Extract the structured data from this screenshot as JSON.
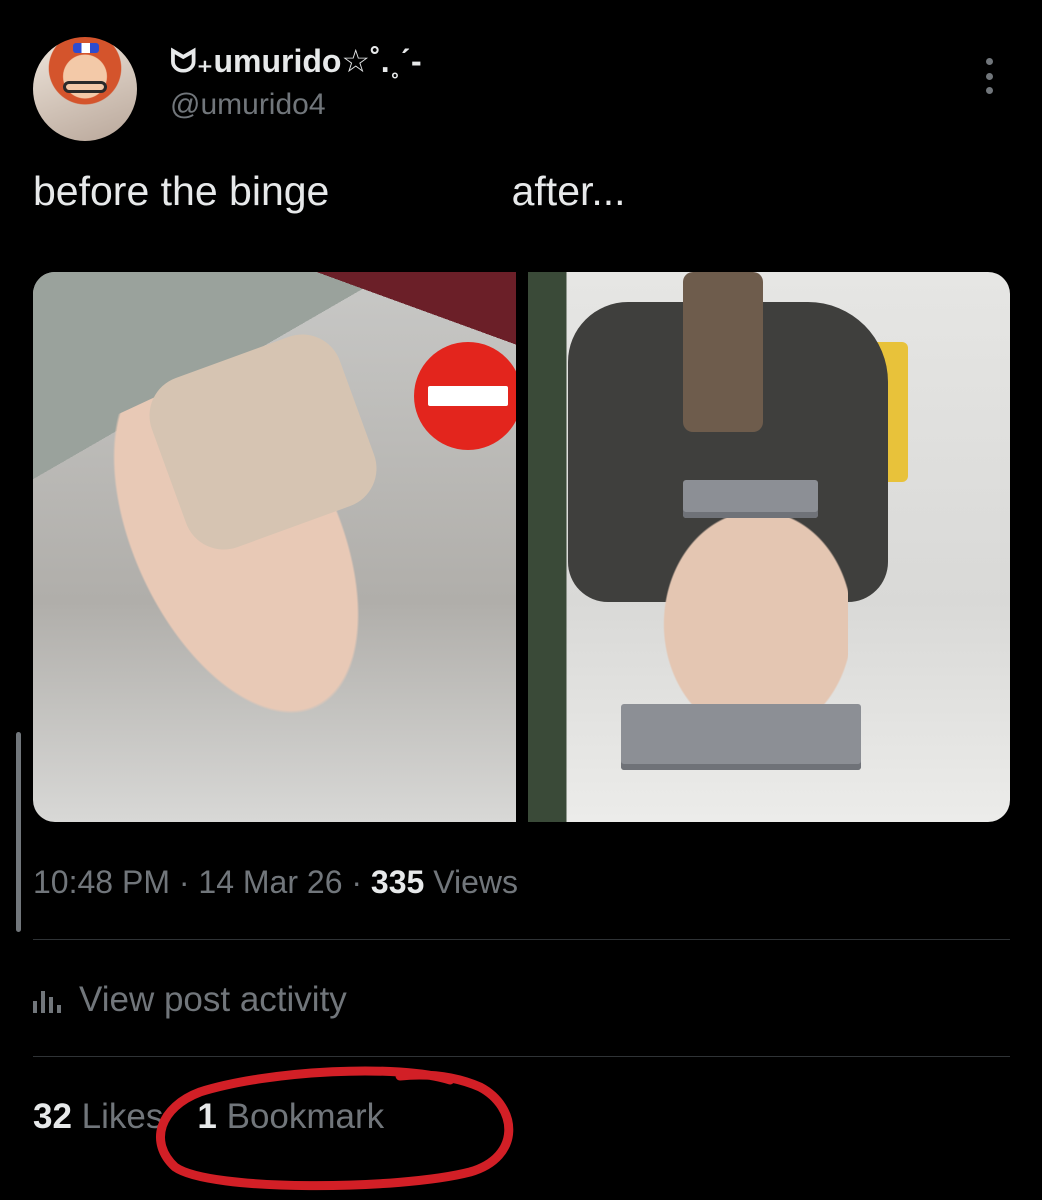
{
  "author": {
    "display_name": "ᗢ₊umurido☆˚.˳ˊ-",
    "handle": "@umurido4"
  },
  "tweet": {
    "text": "before the binge                after..."
  },
  "media": {
    "count": 2
  },
  "meta": {
    "time": "10:48 PM",
    "separator": " · ",
    "date": "14 Mar 26",
    "views_count": "335",
    "views_label": " Views"
  },
  "activity": {
    "label": "View post activity",
    "icon": "analytics-bar-icon"
  },
  "stats": {
    "likes_count": "32",
    "likes_label": "Likes",
    "bookmarks_count": "1",
    "bookmarks_label": "Bookmark"
  },
  "annotation": {
    "color": "#d21f26",
    "shape": "hand-drawn-circle"
  },
  "colors": {
    "background": "#000000",
    "primary_text": "#e7e9ea",
    "secondary_text": "#71767b",
    "divider": "#2f3336"
  }
}
